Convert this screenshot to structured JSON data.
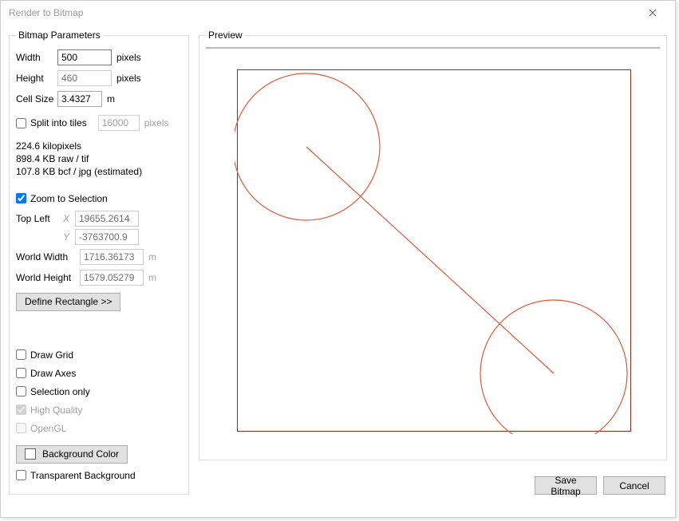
{
  "title": "Render to Bitmap",
  "params": {
    "legend": "Bitmap Parameters",
    "width_label": "Width",
    "width_value": "500",
    "height_label": "Height",
    "height_value": "460",
    "pixels_unit": "pixels",
    "cellsize_label": "Cell Size",
    "cellsize_value": "3.4327",
    "m_unit": "m",
    "split_tiles_label": "Split into tiles",
    "split_tiles_value": "16000",
    "info_line1": "224.6 kilopixels",
    "info_line2": "898.4 KB raw / tif",
    "info_line3": "107.8 KB bcf / jpg (estimated)",
    "zoom_label": "Zoom to Selection",
    "topleft_label": "Top Left",
    "x_label": "X",
    "y_label": "Y",
    "topleft_x": "19655.2614",
    "topleft_y": "-3763700.9",
    "worldwidth_label": "World Width",
    "worldwidth_value": "1716.36173",
    "worldheight_label": "World Height",
    "worldheight_value": "1579.05279",
    "define_btn": "Define Rectangle >>",
    "drawgrid_label": "Draw Grid",
    "drawaxes_label": "Draw Axes",
    "selonly_label": "Selection only",
    "hq_label": "High Quality",
    "opengl_label": "OpenGL",
    "bgcolor_label": "Background Color",
    "transparent_label": "Transparent Background"
  },
  "preview": {
    "legend": "Preview"
  },
  "buttons": {
    "save": "Save Bitmap",
    "cancel": "Cancel"
  }
}
